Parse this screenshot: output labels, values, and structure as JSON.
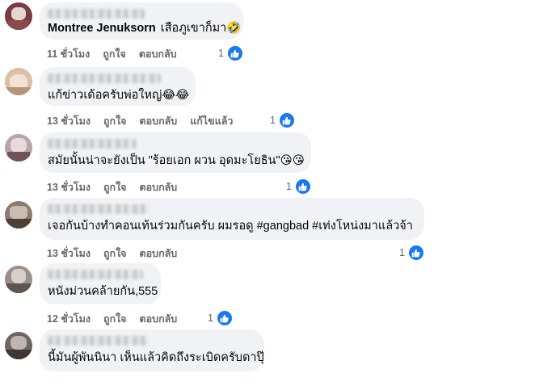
{
  "comments": [
    {
      "author": "Montree Jenuksorn",
      "text": "เสือภูเขาก็มา🤣",
      "time": "11 ชั่วโมง",
      "like_label": "ถูกใจ",
      "reply_label": "ตอบกลับ",
      "edited_label": "",
      "reaction_count": "1",
      "avatar_colors": [
        "#5a2d32",
        "#e3d6d3",
        "#8a4a4c"
      ]
    },
    {
      "author": "",
      "text": "แก้ข่าวเด้อครับพ่อใหญ่😂😂",
      "time": "13 ชั่วโมง",
      "like_label": "ถูกใจ",
      "reply_label": "ตอบกลับ",
      "edited_label": "แก้ไขแล้ว",
      "reaction_count": "1",
      "avatar_colors": [
        "#d9c0a6",
        "#f1e3d4",
        "#b89378"
      ]
    },
    {
      "author": "",
      "text": "สมัยนั้นน่าจะยังเป็น \"ร้อยเอก ผวน อุดมะโยธิน\"😘😘",
      "time": "13 ชั่วโมง",
      "like_label": "ถูกใจ",
      "reply_label": "ตอบกลับ",
      "edited_label": "",
      "reaction_count": "1",
      "avatar_colors": [
        "#b9a4a8",
        "#e7d9dc",
        "#6f5358"
      ]
    },
    {
      "author": "",
      "text": "เจอกันบ้างทำคอนเท้นร่วมกันครับ ผมรอดู #gangbad #เท่งโหน่งมาแล้วจ้า",
      "time": "13 ชั่วโมง",
      "like_label": "ถูกใจ",
      "reply_label": "ตอบกลับ",
      "edited_label": "",
      "reaction_count": "1",
      "avatar_colors": [
        "#8c7b6e",
        "#cbbcb0",
        "#4c4038"
      ]
    },
    {
      "author": "",
      "text": "หนังม่วนคล้ายกัน,555",
      "time": "12 ชั่วโมง",
      "like_label": "ถูกใจ",
      "reply_label": "ตอบกลับ",
      "edited_label": "",
      "reaction_count": "1",
      "avatar_colors": [
        "#9b8f8a",
        "#d6cfcb",
        "#5e5450"
      ]
    },
    {
      "author": "",
      "text": "นี้มันผู้พันนินา เห็นแล้วคิดถึงระเบิดครับดาปุ๊",
      "time": "",
      "like_label": "",
      "reply_label": "",
      "edited_label": "",
      "reaction_count": "",
      "avatar_colors": [
        "#6e6460",
        "#bfb5ae",
        "#3e3733"
      ]
    }
  ],
  "colors": {
    "bubble": "#f0f2f5",
    "like_blue": "#1877f2",
    "meta_gray": "#65676b"
  },
  "icons": {
    "reaction": "thumbs-up-icon"
  }
}
